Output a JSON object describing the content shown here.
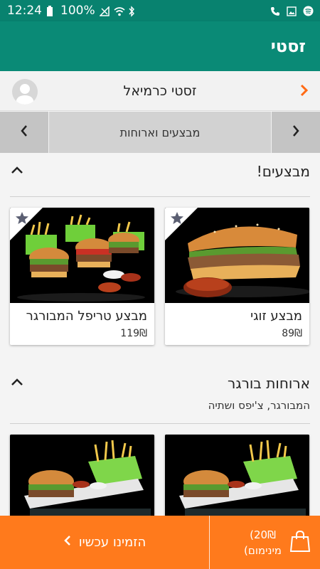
{
  "status_bar": {
    "time": "12:24",
    "battery": "100%",
    "icons": [
      "battery-icon",
      "no-sim-icon",
      "wifi-icon",
      "bluetooth-icon",
      "call-icon",
      "gallery-icon",
      "spotify-icon"
    ]
  },
  "app_bar": {
    "title": "זסטי"
  },
  "branch": {
    "name": "זסטי כרמיאל",
    "icons": [
      "avatar-icon",
      "chevron-right-icon"
    ]
  },
  "category_nav": {
    "label": "מבצעים וארוחות"
  },
  "sections": [
    {
      "title": "מבצעים!",
      "subtitle": "",
      "items": [
        {
          "name": "מבצע זוגי",
          "price": "89₪",
          "image": "burger-sandwich-photo"
        },
        {
          "name": "מבצע טריפל המבורגר",
          "price": "119₪",
          "image": "three-burgers-photo"
        }
      ]
    },
    {
      "title": "ארוחות בורגר",
      "subtitle": "המבורגר, צ'יפס ושתיה",
      "items": [
        {
          "name": "",
          "price": "",
          "image": "burger-meal-photo"
        },
        {
          "name": "",
          "price": "",
          "image": "burger-meal-photo"
        }
      ]
    }
  ],
  "bottom_bar": {
    "order_label": "הזמינו עכשיו",
    "cart_amount": "20₪)",
    "cart_min": "מינימום)"
  },
  "colors": {
    "primary": "#0a8a76",
    "accent": "#ff7a1c",
    "orange_chevron": "#ff6a14"
  }
}
